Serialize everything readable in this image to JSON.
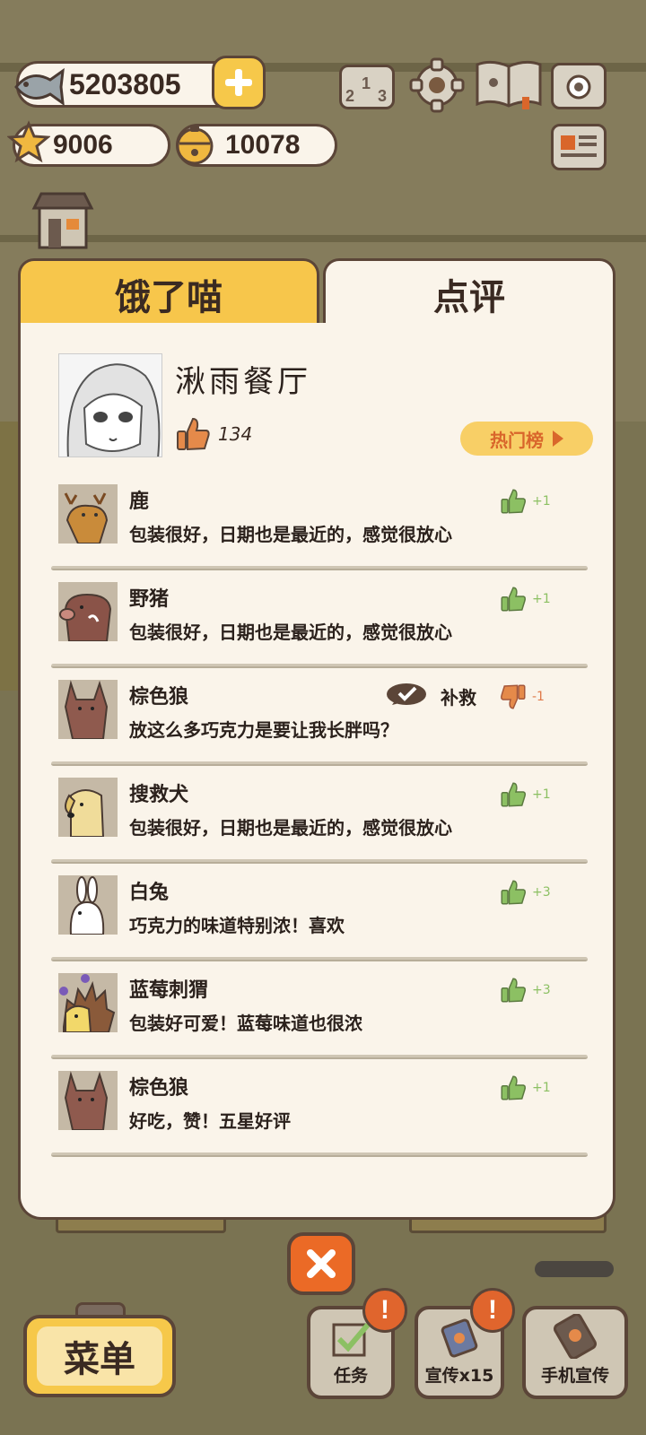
{
  "hud": {
    "fish": "5203805",
    "stars": "9006",
    "bells": "10078"
  },
  "tabs": {
    "left": "饿了喵",
    "right": "点评"
  },
  "profile": {
    "restaurant_name": "湫雨餐厅",
    "likes": "134",
    "hot_list": "热门榜"
  },
  "reviews": [
    {
      "name": "鹿",
      "text": "包装很好，日期也是最近的，感觉很放心",
      "score": "+1",
      "thumb": "up"
    },
    {
      "name": "野猪",
      "text": "包装很好，日期也是最近的，感觉很放心",
      "score": "+1",
      "thumb": "up"
    },
    {
      "name": "棕色狼",
      "text": "放这么多巧克力是要让我长胖吗？",
      "score": "-1",
      "thumb": "down",
      "remedy": "补救"
    },
    {
      "name": "搜救犬",
      "text": "包装很好，日期也是最近的，感觉很放心",
      "score": "+1",
      "thumb": "up"
    },
    {
      "name": "白兔",
      "text": "巧克力的味道特别浓！喜欢",
      "score": "+3",
      "thumb": "up"
    },
    {
      "name": "蓝莓刺猬",
      "text": "包装好可爱！蓝莓味道也很浓",
      "score": "+3",
      "thumb": "up"
    },
    {
      "name": "棕色狼",
      "text": "好吃，赞！五星好评",
      "score": "+1",
      "thumb": "up"
    }
  ],
  "bottom": {
    "menu": "菜单",
    "tasks": "任务",
    "promo": "宣传x15",
    "phone_promo": "手机宣传",
    "alert_mark": "!"
  },
  "colors": {
    "accent_yellow": "#f7c64b",
    "panel": "#faf4ea",
    "outline": "#5b4538",
    "thumb_up": "#8cc063",
    "thumb_down": "#e07a4a",
    "close": "#eb6a26"
  }
}
